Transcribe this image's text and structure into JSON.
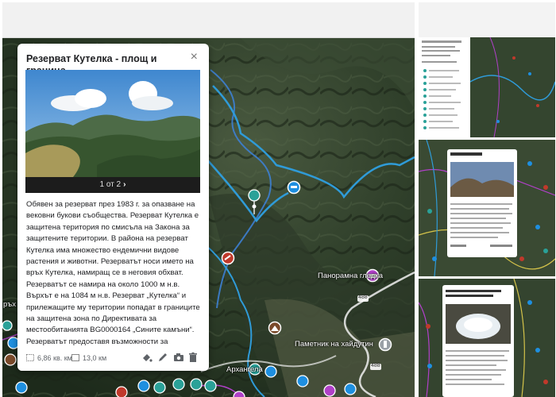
{
  "popup": {
    "title": "Резерват Кутелка - площ и граница",
    "pager": "1 от 2",
    "pager_next": "›",
    "close": "×",
    "description": "Обявен за резерват през 1983 г. за опазване на вековни букови съобщества. Резерват Кутелка е защитена територия по смисъла на Закона за защитените територии. В района на резерват Кутелка има множество ендемични видове растения и животни. Резерватът носи името на връх Кутелка, намиращ се в неговия обхват. Резерватът се намира на около 1000 м н.в. Върхът е на 1084 м н.в. Резерват „Кутелка“ и прилежащите му територии попадат в границите на защитена зона по Директивата за местообитанията BG0000164 „Сините камъни“. Резерватът предоставя възможности за",
    "area": "6,86 кв. км",
    "length": "13,0 км",
    "tools": [
      "style-icon",
      "edit-icon",
      "camera-icon",
      "delete-icon"
    ]
  },
  "map": {
    "labels": {
      "panorama": "Панорамна гледка",
      "monument": "Паметник на хайдутин",
      "arhangela": "Архангела",
      "vrah": "ръх К",
      "road1": "488",
      "road2": "488"
    }
  },
  "colors": {
    "boundary": "#2f9bd8",
    "river": "#3d7fd1",
    "road": "#f0f0f0",
    "purple_marker": "#b040c8",
    "teal_marker": "#2aa198",
    "red_marker": "#c0392b"
  }
}
